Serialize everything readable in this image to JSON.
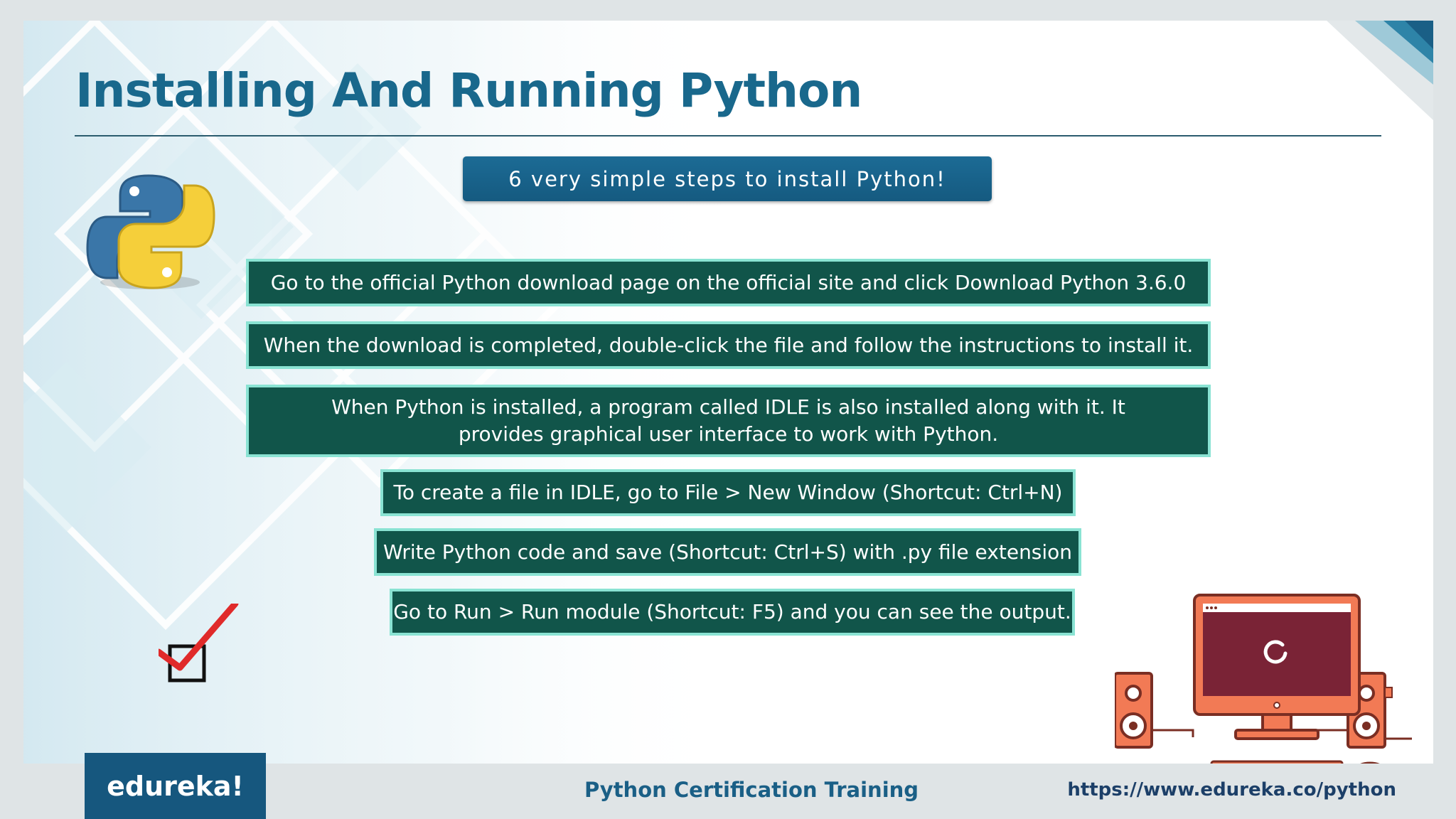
{
  "slide": {
    "title": "Installing And Running Python",
    "banner": "6 very simple steps to install Python!",
    "steps": [
      "Go to the official Python download page on the official site and click Download Python 3.6.0",
      "When the download is completed, double-click the file and follow the instructions to install it.",
      "When Python is installed, a program called IDLE is also installed along with it. It provides graphical user interface to work with Python.",
      "To create a file in IDLE, go to File > New Window (Shortcut: Ctrl+N)",
      "Write Python code and save (Shortcut: Ctrl+S) with .py file extension",
      "Go to Run > Run module (Shortcut: F5) and you can see the output."
    ]
  },
  "footer": {
    "brand": "edureka!",
    "course": "Python Certification Training",
    "url": "https://www.edureka.co/python"
  },
  "icons": {
    "logo": "python-logo-icon",
    "check": "checkbox-checked-icon",
    "computer": "desktop-computer-icon"
  },
  "colors": {
    "title": "#19688c",
    "banner": "#1c6b95",
    "step_fill": "#11554a",
    "step_border": "#8ae3d3",
    "brand": "#16577e"
  }
}
